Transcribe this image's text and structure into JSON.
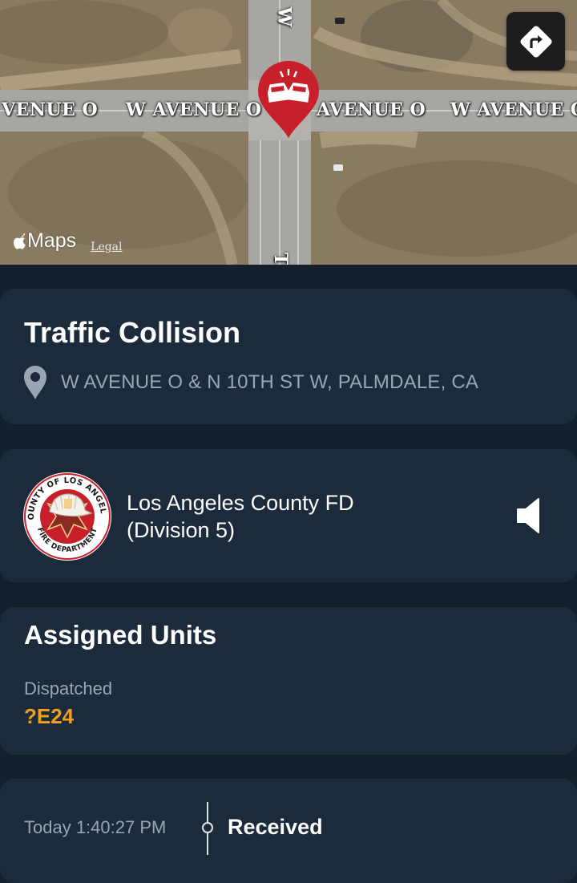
{
  "map": {
    "road_labels": [
      "VENUE O",
      "W AVENUE O",
      "AVENUE O",
      "W AVENUE O"
    ],
    "vertical_labels": [
      "W",
      "T"
    ],
    "brand": "Maps",
    "legal": "Legal",
    "pin_color": "#c8202b",
    "pin_icon": "car-collision-icon",
    "directions_icon": "directions-icon"
  },
  "incident": {
    "title": "Traffic Collision",
    "address": "W AVENUE O & N 10TH ST W, PALMDALE, CA",
    "address_icon": "location-pin-icon"
  },
  "agency": {
    "name_line1": "Los Angeles County FD",
    "name_line2": "(Division 5)",
    "logo": {
      "top_text": "COUNTY OF LOS ANGELES",
      "bottom_text": "FIRE DEPARTMENT"
    },
    "audio_icon": "speaker-icon"
  },
  "units": {
    "title": "Assigned Units",
    "status": "Dispatched",
    "unit_id": "?E24",
    "unit_color": "#f0a020"
  },
  "timeline": {
    "time": "Today 1:40:27 PM",
    "event": "Received"
  }
}
